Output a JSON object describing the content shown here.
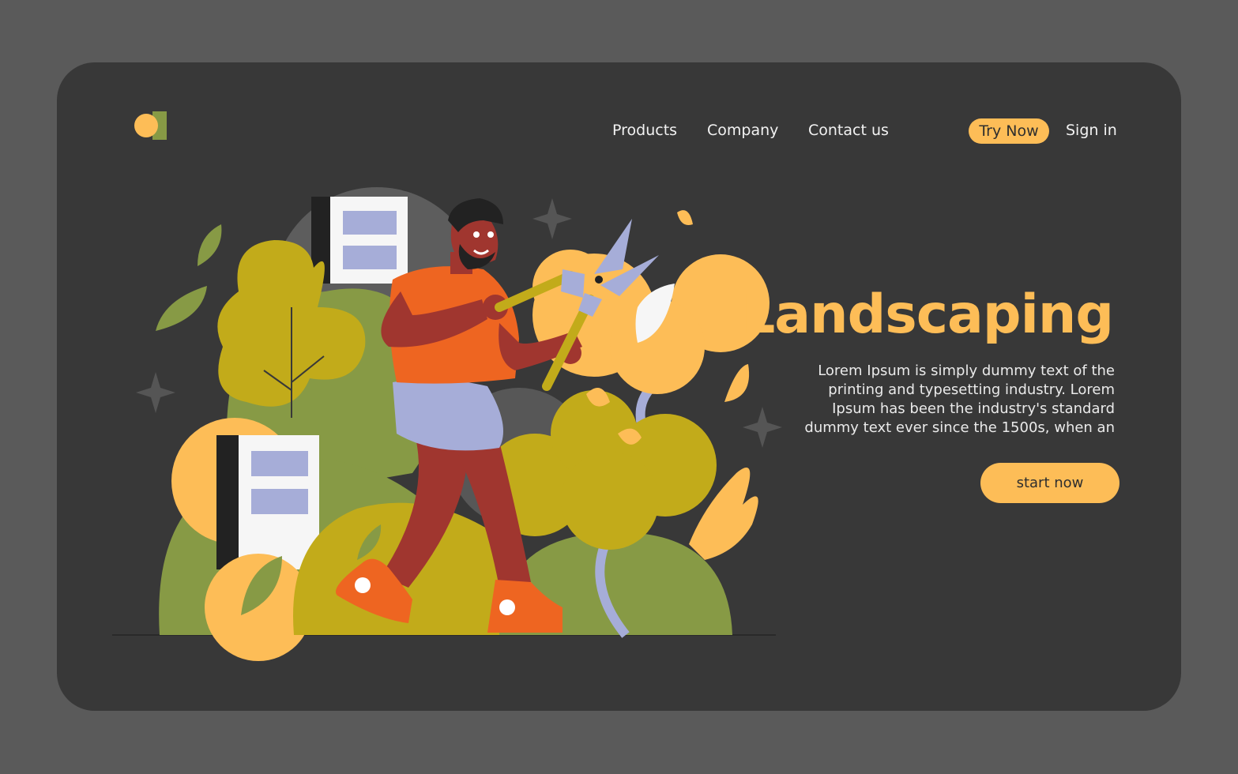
{
  "brand": {
    "logo_icon": "brand-logo-icon",
    "colors": {
      "circle": "#fdbd57",
      "bar": "#879a45"
    }
  },
  "nav": {
    "items": [
      {
        "label": "Products"
      },
      {
        "label": "Company"
      },
      {
        "label": "Contact us"
      }
    ],
    "try_now_label": "Try Now",
    "sign_in_label": "Sign in"
  },
  "hero": {
    "title": "Landscaping",
    "body": "Lorem Ipsum is simply dummy text of the printing and typesetting industry. Lorem Ipsum has been the industry's standard dummy text ever since the 1500s, when an",
    "cta_label": "start now"
  },
  "theme": {
    "page_bg": "#5a5a5a",
    "card_bg": "#383838",
    "accent": "#fdbd57",
    "text": "#f2f2f2"
  }
}
